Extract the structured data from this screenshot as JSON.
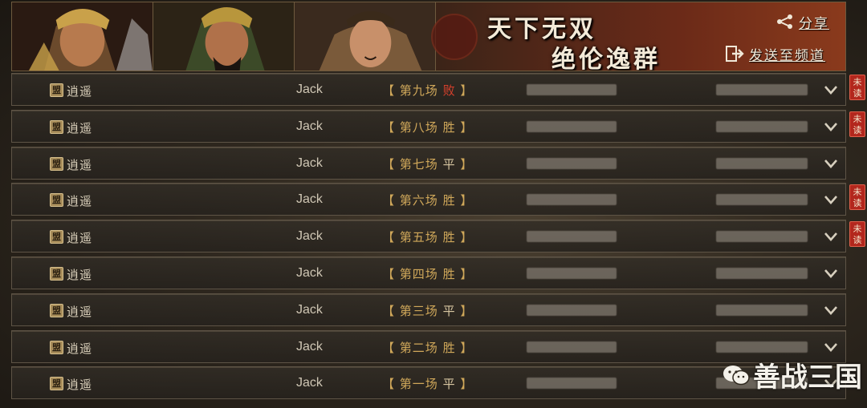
{
  "banner": {
    "slogan_line1": "天下无双",
    "slogan_line2": "绝伦逸群",
    "share_label": "分享",
    "send_label": "发送至频道",
    "icons": [
      "share-icon",
      "send-channel-icon"
    ]
  },
  "list": {
    "rows": [
      {
        "badge": "盟",
        "name": "逍遥",
        "opponent": "Jack",
        "battle_open": "【 ",
        "battle": "第九场",
        "result": "败",
        "result_type": "lose",
        "battle_close": " 】",
        "unread": true
      },
      {
        "badge": "盟",
        "name": "逍遥",
        "opponent": "Jack",
        "battle_open": "【 ",
        "battle": "第八场",
        "result": "胜",
        "result_type": "win",
        "battle_close": " 】",
        "unread": true
      },
      {
        "badge": "盟",
        "name": "逍遥",
        "opponent": "Jack",
        "battle_open": "【 ",
        "battle": "第七场",
        "result": "平",
        "result_type": "draw",
        "battle_close": " 】",
        "unread": false
      },
      {
        "badge": "盟",
        "name": "逍遥",
        "opponent": "Jack",
        "battle_open": "【 ",
        "battle": "第六场",
        "result": "胜",
        "result_type": "win",
        "battle_close": " 】",
        "unread": true
      },
      {
        "badge": "盟",
        "name": "逍遥",
        "opponent": "Jack",
        "battle_open": "【 ",
        "battle": "第五场",
        "result": "胜",
        "result_type": "win",
        "battle_close": " 】",
        "unread": true
      },
      {
        "badge": "盟",
        "name": "逍遥",
        "opponent": "Jack",
        "battle_open": "【 ",
        "battle": "第四场",
        "result": "胜",
        "result_type": "win",
        "battle_close": " 】",
        "unread": false
      },
      {
        "badge": "盟",
        "name": "逍遥",
        "opponent": "Jack",
        "battle_open": "【 ",
        "battle": "第三场",
        "result": "平",
        "result_type": "draw",
        "battle_close": " 】",
        "unread": false
      },
      {
        "badge": "盟",
        "name": "逍遥",
        "opponent": "Jack",
        "battle_open": "【 ",
        "battle": "第二场",
        "result": "胜",
        "result_type": "win",
        "battle_close": " 】",
        "unread": false
      },
      {
        "badge": "盟",
        "name": "逍遥",
        "opponent": "Jack",
        "battle_open": "【 ",
        "battle": "第一场",
        "result": "平",
        "result_type": "draw",
        "battle_close": " 】",
        "unread": false
      }
    ],
    "unread_label": "未读"
  },
  "watermark": {
    "text": "善战三国",
    "icon": "wechat-icon"
  },
  "colors": {
    "lose": "#d8402c",
    "win": "#d0a85a",
    "draw": "#d8c7a2",
    "unread_bg": "#b3271d",
    "accent": "#d0a85a"
  }
}
